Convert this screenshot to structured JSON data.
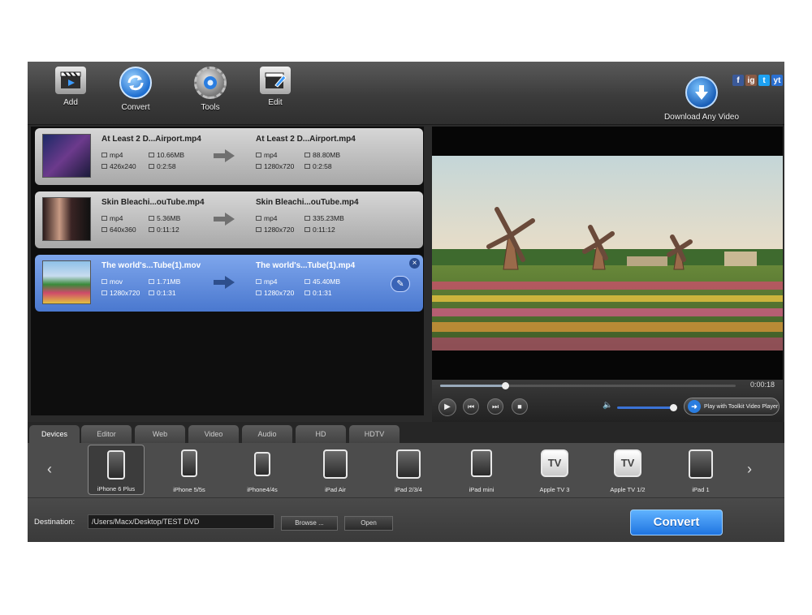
{
  "toolbar": {
    "add": "Add",
    "convert": "Convert",
    "tools": "Tools",
    "edit": "Edit",
    "download": "Download Any Video",
    "social": [
      "f",
      "ig",
      "t",
      "yt"
    ]
  },
  "files": [
    {
      "src_name": "At Least 2 D...Airport.mp4",
      "src_format": "mp4",
      "src_size": "10.66MB",
      "src_res": "426x240",
      "src_dur": "0:2:58",
      "out_name": "At Least 2 D...Airport.mp4",
      "out_format": "mp4",
      "out_size": "88.80MB",
      "out_res": "1280x720",
      "out_dur": "0:2:58"
    },
    {
      "src_name": "Skin Bleachi...ouTube.mp4",
      "src_format": "mp4",
      "src_size": "5.36MB",
      "src_res": "640x360",
      "src_dur": "0:11:12",
      "out_name": "Skin Bleachi...ouTube.mp4",
      "out_format": "mp4",
      "out_size": "335.23MB",
      "out_res": "1280x720",
      "out_dur": "0:11:12"
    },
    {
      "src_name": "The world's...Tube(1).mov",
      "src_format": "mov",
      "src_size": "1.71MB",
      "src_res": "1280x720",
      "src_dur": "0:1:31",
      "out_name": "The world's...Tube(1).mp4",
      "out_format": "mp4",
      "out_size": "45.40MB",
      "out_res": "1280x720",
      "out_dur": "0:1:31"
    }
  ],
  "player": {
    "time": "0:00:18",
    "progress": 0.22,
    "volume": 0.95,
    "play_with": "Play with Toolkit Video Player"
  },
  "tabs": [
    "Devices",
    "Editor",
    "Web",
    "Video",
    "Audio",
    "HD",
    "HDTV"
  ],
  "devices": [
    {
      "label": "iPhone 6 Plus",
      "kind": "phone"
    },
    {
      "label": "iPhone 5/5s",
      "kind": "phone"
    },
    {
      "label": "iPhone4/4s",
      "kind": "phone-small"
    },
    {
      "label": "iPad Air",
      "kind": "tablet"
    },
    {
      "label": "iPad 2/3/4",
      "kind": "tablet"
    },
    {
      "label": "iPad mini",
      "kind": "tablet-small"
    },
    {
      "label": "Apple TV 3",
      "kind": "tv",
      "tv_text": "TV"
    },
    {
      "label": "Apple TV 1/2",
      "kind": "tv",
      "tv_text": "TV"
    },
    {
      "label": "iPad 1",
      "kind": "tablet"
    }
  ],
  "destination": {
    "label": "Destination:",
    "path": "/Users/Macx/Desktop/TEST DVD",
    "browse": "Browse ...",
    "open": "Open"
  },
  "convert_button": "Convert",
  "colors": {
    "accent": "#2f7fe6",
    "selected_item": "#5a86d8"
  }
}
